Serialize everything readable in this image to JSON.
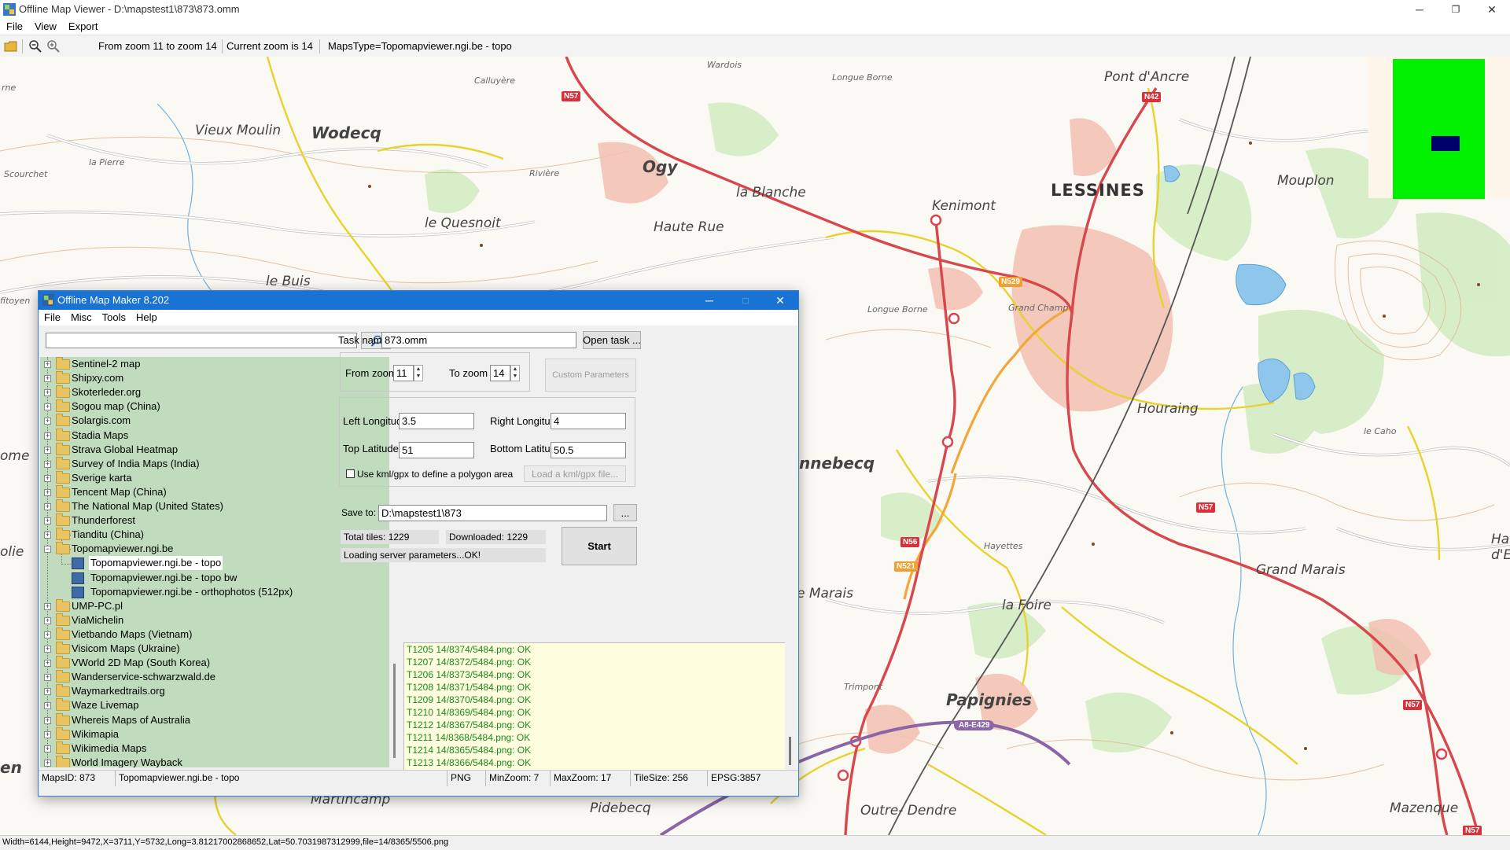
{
  "app": {
    "title": "Offline Map Viewer - D:\\mapstest1\\873\\873.omm",
    "menu": [
      "File",
      "View",
      "Export"
    ],
    "toolbar": {
      "zoom_range": "From zoom 11 to zoom 14",
      "current_zoom": "Current zoom is 14",
      "maps_type": "MapsType=Topomapviewer.ngi.be - topo"
    },
    "status": "Width=6144,Height=9472,X=3711,Y=5732,Long=3.81217002868652,Lat=50.7031987312999,file=14/8365/5506.png"
  },
  "map": {
    "places": [
      {
        "name": "Vieux Moulin",
        "cls": "med"
      },
      {
        "name": "Wodecq",
        "cls": "big"
      },
      {
        "name": "Ogy",
        "cls": "big"
      },
      {
        "name": "la Blanche",
        "cls": "med"
      },
      {
        "name": "le Quesnoit",
        "cls": "med"
      },
      {
        "name": "Haute Rue",
        "cls": "med"
      },
      {
        "name": "Kenimont",
        "cls": "med"
      },
      {
        "name": "LESSINES",
        "cls": "city"
      },
      {
        "name": "Pont d'Ancre",
        "cls": "med"
      },
      {
        "name": "Mouplon",
        "cls": "med"
      },
      {
        "name": "le Buis",
        "cls": "med"
      },
      {
        "name": "Grand Champ",
        "cls": "xs"
      },
      {
        "name": "Longue Borne",
        "cls": "xs"
      },
      {
        "name": "Houraing",
        "cls": "med"
      },
      {
        "name": "le Caho",
        "cls": "xs"
      },
      {
        "name": "nnebecq",
        "cls": "big"
      },
      {
        "name": "Hayettes",
        "cls": "xs"
      },
      {
        "name": "Grand Marais",
        "cls": "med"
      },
      {
        "name": "e Marais",
        "cls": "med"
      },
      {
        "name": "la Foire",
        "cls": "med"
      },
      {
        "name": "Papignies",
        "cls": "big"
      },
      {
        "name": "Trimpont",
        "cls": "xs"
      },
      {
        "name": "Martincamp",
        "cls": "med"
      },
      {
        "name": "Pidebecq",
        "cls": "med"
      },
      {
        "name": "Outre- Dendre",
        "cls": "med"
      },
      {
        "name": "Mazenque",
        "cls": "med"
      },
      {
        "name": "Calluyère",
        "cls": "xs"
      },
      {
        "name": "Wardois",
        "cls": "xs"
      },
      {
        "name": "Longue Borne",
        "cls": "xs"
      },
      {
        "name": "Rivière",
        "cls": "xs"
      },
      {
        "name": "Scourchet",
        "cls": "xs"
      },
      {
        "name": "la Pierre",
        "cls": "xs"
      },
      {
        "name": "ome",
        "cls": "med"
      },
      {
        "name": "olie",
        "cls": "med"
      },
      {
        "name": "fitoyen",
        "cls": "xs"
      },
      {
        "name": "Har",
        "cls": "med"
      },
      {
        "name": "d'E",
        "cls": "med"
      },
      {
        "name": "en",
        "cls": "big"
      },
      {
        "name": "rne",
        "cls": "xs"
      }
    ],
    "badges": [
      {
        "text": "N57",
        "color": "red"
      },
      {
        "text": "N42",
        "color": "red"
      },
      {
        "text": "N529",
        "color": "orange"
      },
      {
        "text": "N57",
        "color": "red"
      },
      {
        "text": "N56",
        "color": "red"
      },
      {
        "text": "N521",
        "color": "orange"
      },
      {
        "text": "N57",
        "color": "red"
      },
      {
        "text": "A8-E429",
        "color": "purple"
      },
      {
        "text": "N57",
        "color": "red"
      }
    ]
  },
  "dialog": {
    "title": "Offline Map Maker 8.202",
    "menu": [
      "File",
      "Misc",
      "Tools",
      "Help"
    ],
    "search_value": "",
    "tree": [
      {
        "label": "Sentinel-2 map",
        "type": "folder"
      },
      {
        "label": "Shipxy.com",
        "type": "folder"
      },
      {
        "label": "Skoterleder.org",
        "type": "folder"
      },
      {
        "label": "Sogou map (China)",
        "type": "folder"
      },
      {
        "label": "Solargis.com",
        "type": "folder"
      },
      {
        "label": "Stadia Maps",
        "type": "folder"
      },
      {
        "label": "Strava Global Heatmap",
        "type": "folder"
      },
      {
        "label": "Survey of India Maps (India)",
        "type": "folder"
      },
      {
        "label": "Sverige karta",
        "type": "folder"
      },
      {
        "label": "Tencent Map (China)",
        "type": "folder"
      },
      {
        "label": "The National Map (United States)",
        "type": "folder"
      },
      {
        "label": "Thunderforest",
        "type": "folder"
      },
      {
        "label": "Tianditu (China)",
        "type": "folder"
      },
      {
        "label": "Topomapviewer.ngi.be",
        "type": "open-folder"
      },
      {
        "label": "Topomapviewer.ngi.be - topo",
        "type": "leaf",
        "selected": true
      },
      {
        "label": "Topomapviewer.ngi.be - topo bw",
        "type": "leaf"
      },
      {
        "label": "Topomapviewer.ngi.be - orthophotos (512px)",
        "type": "leaf"
      },
      {
        "label": "UMP-PC.pl",
        "type": "folder"
      },
      {
        "label": "ViaMichelin",
        "type": "folder"
      },
      {
        "label": "Vietbando Maps (Vietnam)",
        "type": "folder"
      },
      {
        "label": "Visicom Maps (Ukraine)",
        "type": "folder"
      },
      {
        "label": "VWorld 2D Map (South Korea)",
        "type": "folder"
      },
      {
        "label": "Wanderservice-schwarzwald.de",
        "type": "folder"
      },
      {
        "label": "Waymarkedtrails.org",
        "type": "folder"
      },
      {
        "label": "Waze Livemap",
        "type": "folder"
      },
      {
        "label": "Whereis Maps of Australia",
        "type": "folder"
      },
      {
        "label": "Wikimapia",
        "type": "folder"
      },
      {
        "label": "Wikimedia Maps",
        "type": "folder"
      },
      {
        "label": "World Imagery Wayback",
        "type": "folder"
      }
    ],
    "task_name_label": "Task name",
    "task_name_value": "873.omm",
    "open_task_label": "Open task ...",
    "from_zoom_label": "From zoom",
    "from_zoom_value": "11",
    "to_zoom_label": "To zoom",
    "to_zoom_value": "14",
    "custom_params_label": "Custom Parameters",
    "left_long_label": "Left Longitude",
    "left_long_value": "3.5",
    "right_long_label": "Right Longitude",
    "right_long_value": "4",
    "top_lat_label": "Top Latitude",
    "top_lat_value": "51",
    "bottom_lat_label": "Bottom Latitude",
    "bottom_lat_value": "50.5",
    "kml_checkbox_label": "Use kml/gpx to define a polygon area",
    "kml_checked": false,
    "load_kml_label": "Load a kml/gpx file...",
    "save_to_label": "Save to:",
    "save_to_value": "D:\\mapstest1\\873",
    "browse_label": "...",
    "total_tiles": "Total tiles: 1229",
    "downloaded": "Downloaded: 1229",
    "loading_status": "Loading server parameters...OK!",
    "start_label": "Start",
    "log": [
      "T1205 14/8374/5484.png: OK",
      "T1207 14/8372/5484.png: OK",
      "T1206 14/8373/5484.png: OK",
      "T1208 14/8371/5484.png: OK",
      "T1209 14/8370/5484.png: OK",
      "T1210 14/8369/5484.png: OK",
      "T1212 14/8367/5484.png: OK",
      "T1211 14/8368/5484.png: OK",
      "T1214 14/8365/5484.png: OK",
      "T1213 14/8366/5484.png: OK"
    ],
    "status": {
      "maps_id": "MapsID: 873",
      "map_name": "Topomapviewer.ngi.be - topo",
      "format": "PNG",
      "min_zoom": "MinZoom: 7",
      "max_zoom": "MaxZoom: 17",
      "tile_size": "TileSize: 256",
      "epsg": "EPSG:3857"
    }
  },
  "colors": {
    "dialog_title_bg": "#1873d3",
    "tree_bg": "#c0dbbd",
    "log_text": "#1a8a1a",
    "log_bg": "#ffffe0",
    "overview_coverage": "#00f000",
    "overview_view": "#00006a"
  },
  "icons": [
    "app-icon",
    "open-folder-icon",
    "zoom-out-icon",
    "zoom-in-icon",
    "search-icon",
    "minimize-icon",
    "maximize-icon",
    "close-icon",
    "folder-icon",
    "map-layer-icon"
  ]
}
